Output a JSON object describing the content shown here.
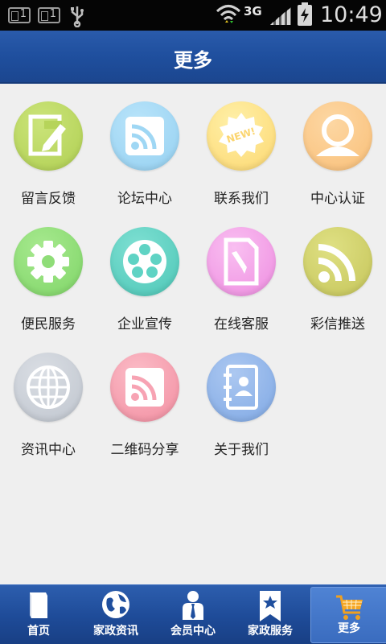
{
  "status": {
    "sim1": "1",
    "sim2": "1",
    "network": "3G",
    "time": "10:49"
  },
  "header": {
    "title": "更多"
  },
  "grid": [
    {
      "label": "留言反馈",
      "icon": "edit-note-icon",
      "color": "#b6d45a"
    },
    {
      "label": "论坛中心",
      "icon": "rss-icon",
      "color": "#9fd7f4"
    },
    {
      "label": "联系我们",
      "icon": "new-badge-icon",
      "color": "#fde082"
    },
    {
      "label": "中心认证",
      "icon": "user-icon",
      "color": "#fbc98a"
    },
    {
      "label": "便民服务",
      "icon": "gear-icon",
      "color": "#8fdd78"
    },
    {
      "label": "企业宣传",
      "icon": "film-reel-icon",
      "color": "#5fd3c4"
    },
    {
      "label": "在线客服",
      "icon": "document-pencil-icon",
      "color": "#f49ee8"
    },
    {
      "label": "彩信推送",
      "icon": "rss-large-icon",
      "color": "#cfd06a"
    },
    {
      "label": "资讯中心",
      "icon": "globe-icon",
      "color": "#c9ced6"
    },
    {
      "label": "二维码分享",
      "icon": "rss-icon",
      "color": "#f7a3b3"
    },
    {
      "label": "关于我们",
      "icon": "contact-book-icon",
      "color": "#8fb5ea"
    }
  ],
  "nav": [
    {
      "label": "首页",
      "icon": "book-icon"
    },
    {
      "label": "家政资讯",
      "icon": "globe-icon"
    },
    {
      "label": "会员中心",
      "icon": "member-icon"
    },
    {
      "label": "家政服务",
      "icon": "bookmark-star-icon"
    },
    {
      "label": "更多",
      "icon": "cart-icon",
      "active": true
    }
  ]
}
